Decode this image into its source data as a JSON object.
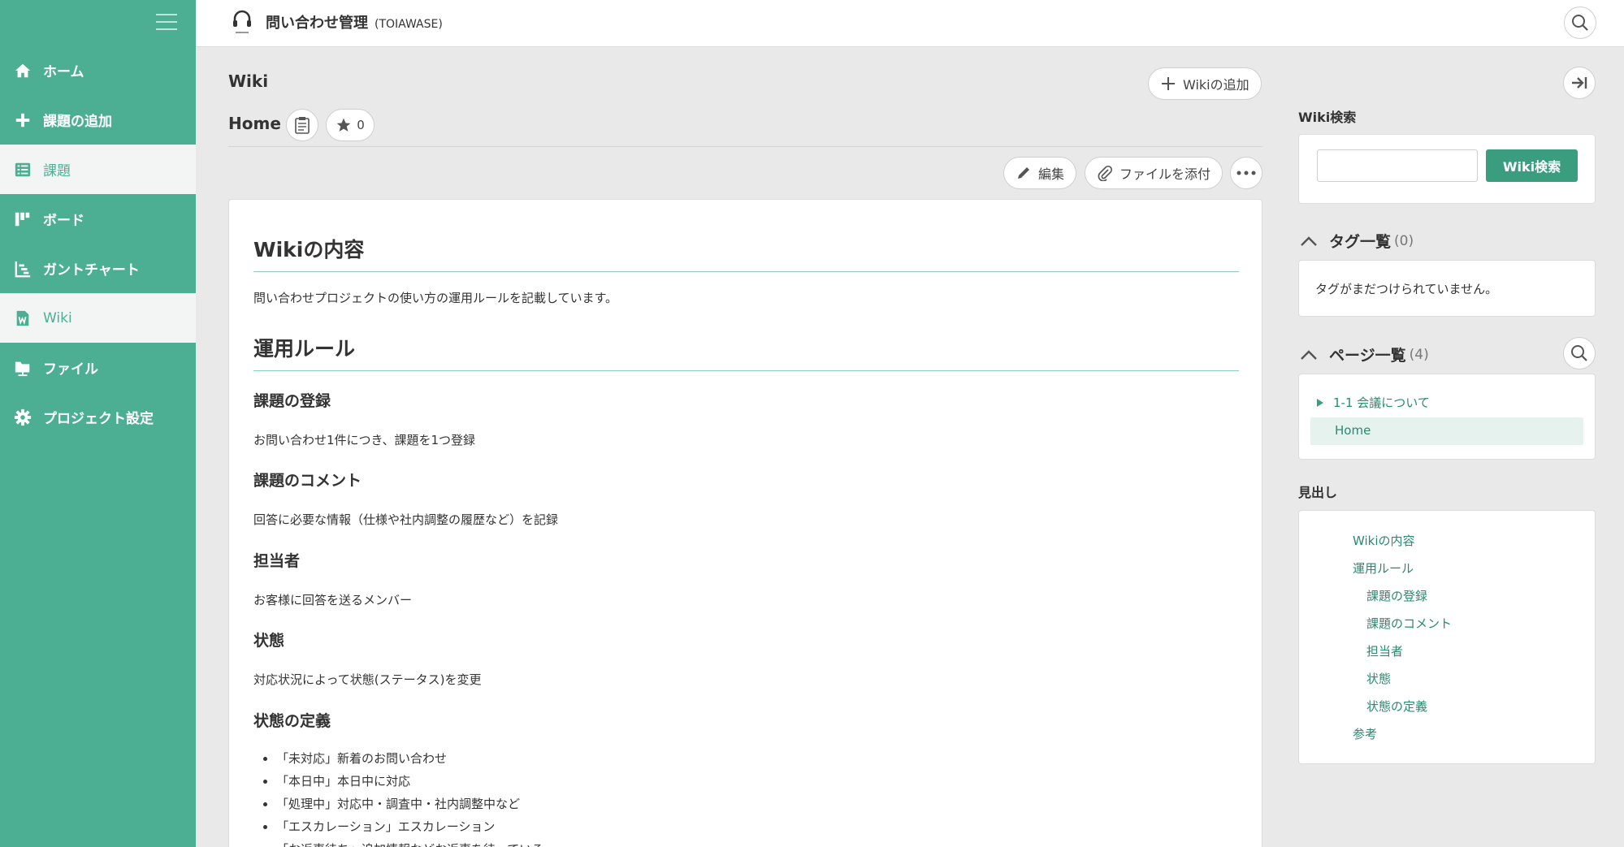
{
  "sidebar": {
    "items": [
      {
        "label": "ホーム",
        "icon": "home-icon"
      },
      {
        "label": "課題の追加",
        "icon": "plus-icon"
      },
      {
        "label": "課題",
        "icon": "list-icon"
      },
      {
        "label": "ボード",
        "icon": "board-icon"
      },
      {
        "label": "ガントチャート",
        "icon": "gantt-icon"
      },
      {
        "label": "Wiki",
        "icon": "wiki-icon"
      },
      {
        "label": "ファイル",
        "icon": "folder-icon"
      },
      {
        "label": "プロジェクト設定",
        "icon": "gear-icon"
      }
    ]
  },
  "header": {
    "project_name": "問い合わせ管理",
    "project_key": "(TOIAWASE)"
  },
  "main": {
    "page_title": "Wiki",
    "add_wiki_label": "Wikiの追加",
    "wiki_name": "Home",
    "star_count": "0",
    "edit_label": "編集",
    "attach_label": "ファイルを添付",
    "content": {
      "h_contents": "Wikiの内容",
      "intro": "問い合わせプロジェクトの使い方の運用ルールを記載しています。",
      "h_rules": "運用ルール",
      "h_register": "課題の登録",
      "register_text": "お問い合わせ1件につき、課題を1つ登録",
      "h_comment": "課題のコメント",
      "comment_text": "回答に必要な情報（仕様や社内調整の履歴など）を記録",
      "h_assignee": "担当者",
      "assignee_text": "お客様に回答を送るメンバー",
      "h_status": "状態",
      "status_text": "対応状況によって状態(ステータス)を変更",
      "h_status_def": "状態の定義",
      "states": [
        "「未対応」新着のお問い合わせ",
        "「本日中」本日中に対応",
        "「処理中」対応中・調査中・社内調整中など",
        "「エスカレーション」エスカレーション",
        "「お返事待ち」追加情報などお返事を待っている"
      ]
    }
  },
  "right": {
    "search_label": "Wiki検索",
    "search_button": "Wiki検索",
    "tags_label": "タグ一覧",
    "tags_count": "(0)",
    "tags_empty": "タグがまだつけられていません。",
    "pages_label": "ページ一覧",
    "pages_count": "(4)",
    "pages": [
      {
        "label": "1-1 会議について"
      },
      {
        "label": "Home"
      }
    ],
    "toc_label": "見出し",
    "toc": [
      "Wikiの内容",
      "運用ルール",
      "課題の登録",
      "課題のコメント",
      "担当者",
      "状態",
      "状態の定義",
      "参考"
    ]
  },
  "colors": {
    "sidebar_bg": "#4caf93",
    "accent": "#3a9e7e",
    "link": "#2a8a6e"
  }
}
